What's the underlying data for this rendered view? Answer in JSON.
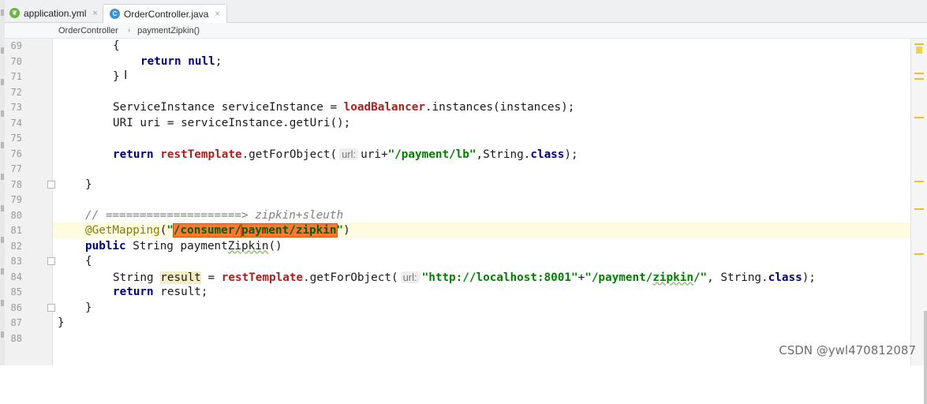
{
  "tabs": [
    {
      "label": "application.yml",
      "icon": "leaf-icon",
      "color": "#6db33f",
      "close": "×",
      "active": false
    },
    {
      "label": "OrderController.java",
      "icon": "class-icon",
      "color": "#3d8fd6",
      "close": "×",
      "active": true
    }
  ],
  "breadcrumb": {
    "class": "OrderController",
    "separator": "›",
    "method": "paymentZipkin()"
  },
  "line_numbers": [
    "69",
    "70",
    "71",
    "72",
    "73",
    "74",
    "75",
    "76",
    "77",
    "78",
    "79",
    "80",
    "81",
    "82",
    "83",
    "84",
    "85",
    "86",
    "87",
    "88"
  ],
  "code": {
    "l69": "{",
    "l70_kw1": "return",
    "l70_kw2": "null",
    "l70_end": ";",
    "l71": "}",
    "l73_a": "ServiceInstance serviceInstance = ",
    "l73_fld": "loadBalancer",
    "l73_b": ".instances(instances);",
    "l74": "URI uri = serviceInstance.getUri();",
    "l76_kw": "return",
    "l76_fld": "restTemplate",
    "l76_a": ".getForObject(",
    "l76_hint": "url:",
    "l76_b": "uri+",
    "l76_str": "\"/payment/lb\"",
    "l76_c": ",String.",
    "l76_kw2": "class",
    "l76_d": ");",
    "l78": "}",
    "l80": "// ====================> zipkin+sleuth",
    "l81_ann": "@GetMapping",
    "l81_a": "(",
    "l81_q1": "\"",
    "l81_sel1": "/consumer/",
    "l81_sel2": "payment/zipkin",
    "l81_q2": "\"",
    "l81_b": ")",
    "l82_kw": "public",
    "l82_a": " String payment",
    "l82_b": "Zipkin",
    "l82_c": "()",
    "l83": "{",
    "l84_a": "String ",
    "l84_var": "result",
    "l84_b": " = ",
    "l84_fld": "restTemplate",
    "l84_c": ".getForObject(",
    "l84_hint": "url:",
    "l84_str1": "\"http://localhost:8001\"",
    "l84_plus": "+",
    "l84_str2a": "\"/payment/",
    "l84_str2b": "zipkin",
    "l84_str2c": "/\"",
    "l84_d": ", String.",
    "l84_kw": "class",
    "l84_e": ");",
    "l85_kw": "return",
    "l85_a": " result;",
    "l86": "}",
    "l87": "}"
  },
  "cursor_glyph": "I",
  "watermark": "CSDN @ywl470812087"
}
